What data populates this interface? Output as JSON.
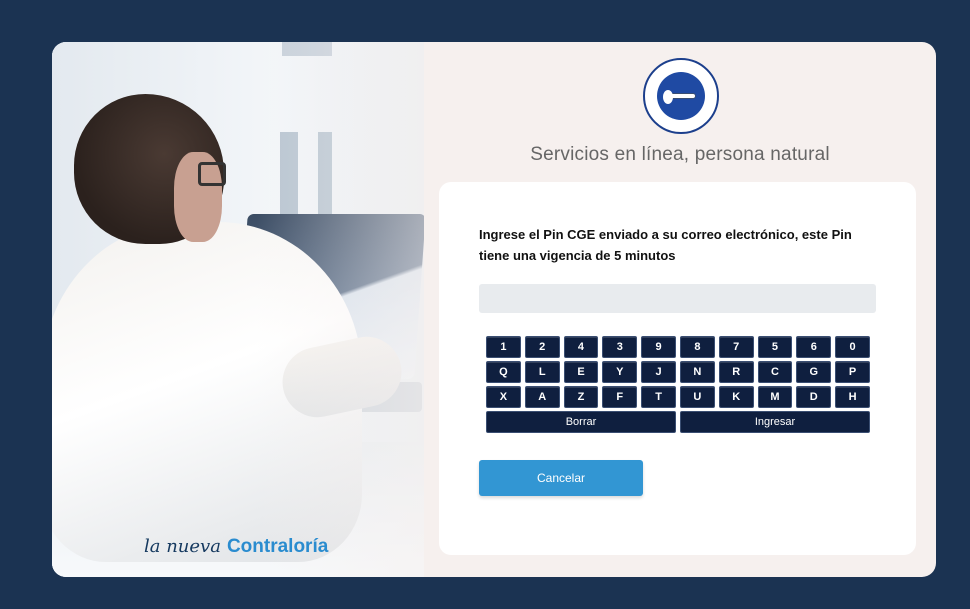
{
  "brand": {
    "script": "la nueva",
    "name": "Contraloría"
  },
  "seal": {
    "alt": "Contraloría General del Estado - Ecuador"
  },
  "subtitle": "Servicios en línea, persona natural",
  "instruction": "Ingrese el Pin CGE enviado a su correo electrónico, este Pin tiene una vigencia de 5 minutos",
  "pin": {
    "value": "",
    "placeholder": ""
  },
  "keypad": {
    "rows": [
      [
        "1",
        "2",
        "4",
        "3",
        "9",
        "8",
        "7",
        "5",
        "6",
        "0"
      ],
      [
        "Q",
        "L",
        "E",
        "Y",
        "J",
        "N",
        "R",
        "C",
        "G",
        "P"
      ],
      [
        "X",
        "A",
        "Z",
        "F",
        "T",
        "U",
        "K",
        "M",
        "D",
        "H"
      ]
    ],
    "delete_label": "Borrar",
    "submit_label": "Ingresar"
  },
  "cancel_label": "Cancelar",
  "colors": {
    "background": "#1b3352",
    "key": "#0f1f3f",
    "accent": "#3296d3",
    "brand_blue": "#2a8ccf"
  }
}
